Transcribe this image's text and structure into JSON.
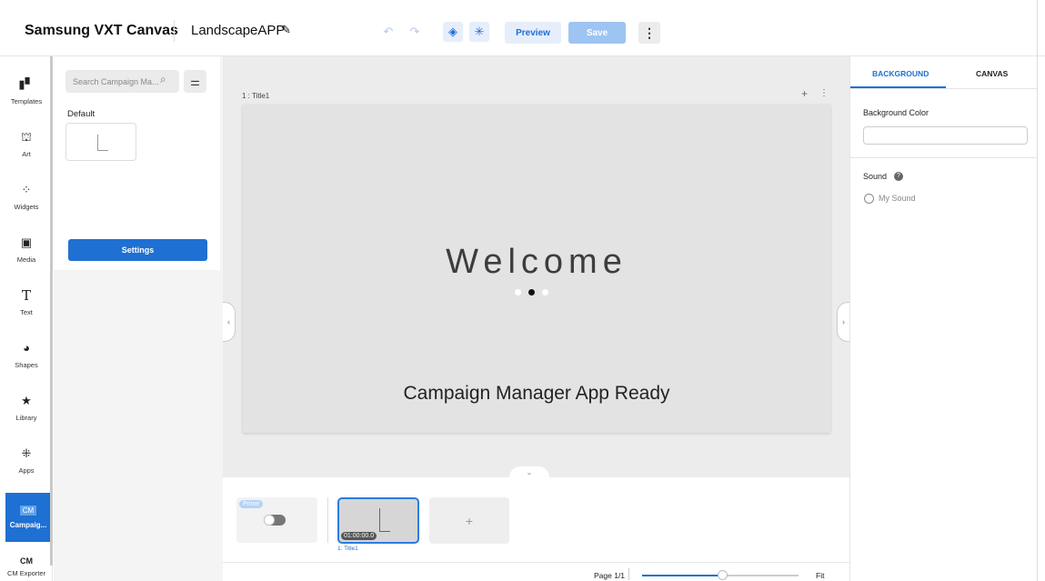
{
  "header": {
    "app_title": "Samsung VXT Canvas",
    "project_name": "LandscapeAPP",
    "preview_label": "Preview",
    "save_label": "Save",
    "more_glyph": "⋮"
  },
  "leftnav": {
    "items": [
      {
        "label": "Templates",
        "icon": "templates-icon"
      },
      {
        "label": "Art",
        "icon": "art-icon"
      },
      {
        "label": "Widgets",
        "icon": "widgets-icon"
      },
      {
        "label": "Media",
        "icon": "media-icon"
      },
      {
        "label": "Text",
        "icon": "text-icon"
      },
      {
        "label": "Shapes",
        "icon": "shapes-icon"
      },
      {
        "label": "Library",
        "icon": "library-icon"
      },
      {
        "label": "Apps",
        "icon": "apps-icon"
      },
      {
        "label": "Campaig...",
        "icon": "cm-icon",
        "badge": "CM",
        "active": true
      },
      {
        "label": "CM Exporter",
        "icon": "cm-exporter-icon",
        "badge": "CM"
      }
    ]
  },
  "panel": {
    "search_placeholder": "Search Campaign Ma...",
    "default_label": "Default",
    "settings_label": "Settings"
  },
  "canvas": {
    "slide_label": "1 : Title1",
    "welcome_text": "Welcome",
    "subtitle_text": "Campaign Manager App Ready",
    "carousel_active_dot": 2
  },
  "timeline": {
    "prime_badge": "Prime",
    "frame_time": "01:00:00.0",
    "frame_label": "1: Title1",
    "add_glyph": "+",
    "page_label": "Page 1/1",
    "zoom_fraction": 0.51,
    "fit_label": "Fit"
  },
  "rightpanel": {
    "tabs": [
      "BACKGROUND",
      "CANVAS"
    ],
    "active_tab": "BACKGROUND",
    "background_color_label": "Background Color",
    "sound_label": "Sound",
    "sound_option": "My Sound"
  },
  "colors": {
    "accent": "#1e70d2",
    "save_disabled": "#9ec4f2",
    "canvas_bg": "#ececec"
  }
}
